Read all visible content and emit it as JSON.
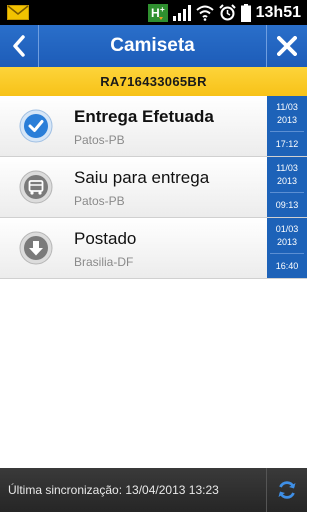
{
  "status_bar": {
    "time": "13h51",
    "icons": [
      "email-icon",
      "h-plus-network-icon",
      "signal-icon",
      "wifi-icon",
      "alarm-icon",
      "battery-icon"
    ]
  },
  "header": {
    "title": "Camiseta",
    "back_icon": "chevron-left-icon",
    "close_icon": "close-icon"
  },
  "tracking_code": "RA716433065BR",
  "events": [
    {
      "status": "Entrega Efetuada",
      "location": "Patos-PB",
      "date_day": "11/03",
      "date_year": "2013",
      "time": "17:12",
      "icon": "check-circle-icon",
      "emphasis": true
    },
    {
      "status": "Saiu para entrega",
      "location": "Patos-PB",
      "date_day": "11/03",
      "date_year": "2013",
      "time": "09:13",
      "icon": "truck-icon",
      "emphasis": false
    },
    {
      "status": "Postado",
      "location": "Brasilia-DF",
      "date_day": "01/03",
      "date_year": "2013",
      "time": "16:40",
      "icon": "arrow-down-circle-icon",
      "emphasis": false
    }
  ],
  "footer": {
    "last_sync": "Última sincronização: 13/04/2013 13:23",
    "sync_icon": "refresh-icon"
  },
  "colors": {
    "header_blue": "#1d5cb8",
    "code_yellow": "#f7c218",
    "date_blue": "#1d62b8",
    "footer_dark": "#262626"
  }
}
